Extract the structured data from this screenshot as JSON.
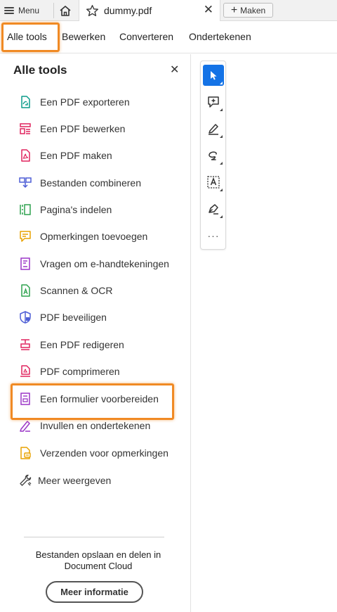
{
  "topbar": {
    "menu_label": "Menu",
    "tab_title": "dummy.pdf",
    "tab_close": "✕",
    "new_label": "Maken",
    "new_plus": "+"
  },
  "menubar": {
    "items": [
      {
        "label": "Alle tools",
        "selected": true
      },
      {
        "label": "Bewerken"
      },
      {
        "label": "Converteren"
      },
      {
        "label": "Ondertekenen"
      }
    ]
  },
  "panel": {
    "title": "Alle tools",
    "close": "✕",
    "tools": [
      {
        "label": "Een PDF exporteren",
        "icon": "export-pdf-icon",
        "color": "#0b9b8a"
      },
      {
        "label": "Een PDF bewerken",
        "icon": "edit-pdf-icon",
        "color": "#e0245e"
      },
      {
        "label": "Een PDF maken",
        "icon": "create-pdf-icon",
        "color": "#e0245e"
      },
      {
        "label": "Bestanden combineren",
        "icon": "combine-files-icon",
        "color": "#4f5fd6"
      },
      {
        "label": "Pagina's indelen",
        "icon": "organize-pages-icon",
        "color": "#2ea24f"
      },
      {
        "label": "Opmerkingen toevoegen",
        "icon": "comment-icon",
        "color": "#e8a200"
      },
      {
        "label": "Vragen om e-handtekeningen",
        "icon": "request-esign-icon",
        "color": "#9b37c7"
      },
      {
        "label": "Scannen & OCR",
        "icon": "scan-ocr-icon",
        "color": "#2ea24f"
      },
      {
        "label": "PDF beveiligen",
        "icon": "protect-pdf-icon",
        "color": "#4f5fd6"
      },
      {
        "label": "Een PDF redigeren",
        "icon": "redact-pdf-icon",
        "color": "#e0245e"
      },
      {
        "label": "PDF comprimeren",
        "icon": "compress-pdf-icon",
        "color": "#e0245e"
      },
      {
        "label": "Een formulier voorbereiden",
        "icon": "prepare-form-icon",
        "color": "#9b37c7"
      },
      {
        "label": "Invullen en ondertekenen",
        "icon": "fill-sign-icon",
        "color": "#9b37c7"
      },
      {
        "label": "Verzenden voor opmerkingen",
        "icon": "send-comments-icon",
        "color": "#e8a200"
      },
      {
        "label": "Meer weergeven",
        "icon": "wrench-icon",
        "color": "#444444"
      }
    ],
    "cloud_text_line1": "Bestanden opslaan en delen in",
    "cloud_text_line2": "Document Cloud",
    "more_info": "Meer informatie"
  },
  "toolbar": {
    "more": "···",
    "buttons": [
      {
        "icon": "select-cursor-icon",
        "active": true
      },
      {
        "icon": "add-comment-icon"
      },
      {
        "icon": "highlight-pen-icon"
      },
      {
        "icon": "draw-freehand-icon"
      },
      {
        "icon": "text-select-icon"
      },
      {
        "icon": "sign-pen-icon"
      },
      {
        "icon": "more-options-icon"
      }
    ]
  },
  "colors": {
    "highlight": "#f08a24",
    "accent": "#1473e6"
  }
}
